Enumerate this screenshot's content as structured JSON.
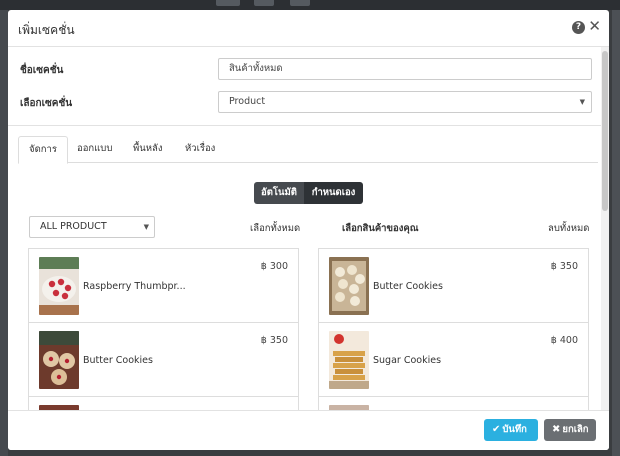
{
  "modal": {
    "title": "เพิ่มเซคชั่น",
    "help_glyph": "?",
    "close_glyph": "✕"
  },
  "form": {
    "section_name_label": "ชื่อเซคชั่น",
    "section_name_value": "สินค้าทั้งหมด",
    "section_type_label": "เลือกเซคชั่น",
    "section_type_value": "Product"
  },
  "tabs": [
    {
      "label": "จัดการ",
      "active": true
    },
    {
      "label": "ออกแบบ",
      "active": false
    },
    {
      "label": "พื้นหลัง",
      "active": false
    },
    {
      "label": "หัวเรื่อง",
      "active": false
    }
  ],
  "mode_toggle": {
    "auto_label": "อัตโนมัติ",
    "custom_label": "กำหนดเอง"
  },
  "left_column": {
    "filter_value": "ALL PRODUCT",
    "select_all_label": "เลือกทั้งหมด",
    "items": [
      {
        "name": "Raspberry Thumbpr...",
        "price": "฿ 300"
      },
      {
        "name": "Butter Cookies",
        "price": "฿ 350"
      }
    ]
  },
  "right_column": {
    "title": "เลือกสินค้าของคุณ",
    "clear_all_label": "ลบทั้งหมด",
    "items": [
      {
        "name": "Butter Cookies",
        "price": "฿ 350"
      },
      {
        "name": "Sugar Cookies",
        "price": "฿ 400"
      }
    ]
  },
  "footer": {
    "save_label": "บันทึก",
    "cancel_label": "ยกเลิก"
  },
  "icons": {
    "save": "check-icon",
    "cancel": "times-icon",
    "dropdown": "caret-down-icon"
  },
  "colors": {
    "save_button": "#2bb0e0",
    "cancel_button": "#6b6f73",
    "toggle_dark": "#2e3236"
  }
}
